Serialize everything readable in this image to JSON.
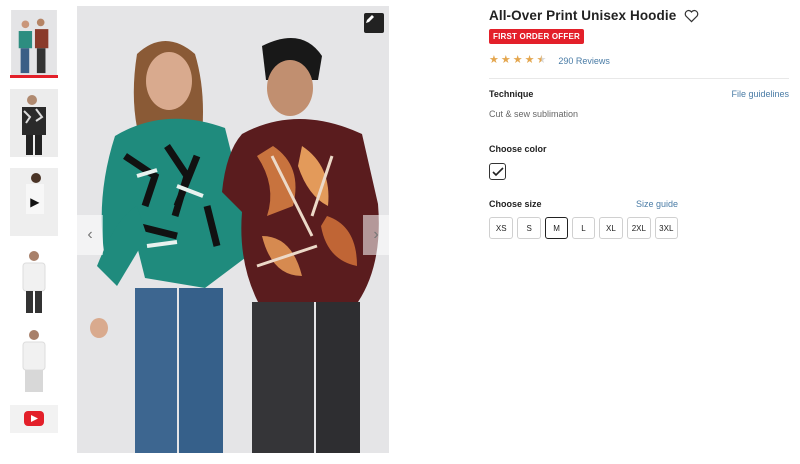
{
  "product": {
    "title": "All-Over Print Unisex Hoodie",
    "badge": "FIRST ORDER OFFER",
    "rating": 4.5,
    "reviews": "290 Reviews"
  },
  "technique": {
    "label": "Technique",
    "link": "File guidelines",
    "value": "Cut & sew sublimation"
  },
  "color": {
    "label": "Choose color"
  },
  "size": {
    "label": "Choose size",
    "link": "Size guide",
    "options": [
      "XS",
      "S",
      "M",
      "L",
      "XL",
      "2XL",
      "3XL"
    ],
    "selected": "M"
  },
  "gallery": {
    "active_index": 0,
    "thumbnails": [
      "couple-photo",
      "woman-dark-hoodie",
      "video",
      "man-white-hoodie-front",
      "man-white-hoodie-side",
      "youtube-video"
    ]
  },
  "icons": {
    "edit": "pencil-icon",
    "favorite": "heart-icon",
    "prev": "chevron-left-icon",
    "next": "chevron-right-icon"
  },
  "colors": {
    "accent": "#e3202a",
    "star": "#e4a64e",
    "link": "#4a7ca6"
  }
}
